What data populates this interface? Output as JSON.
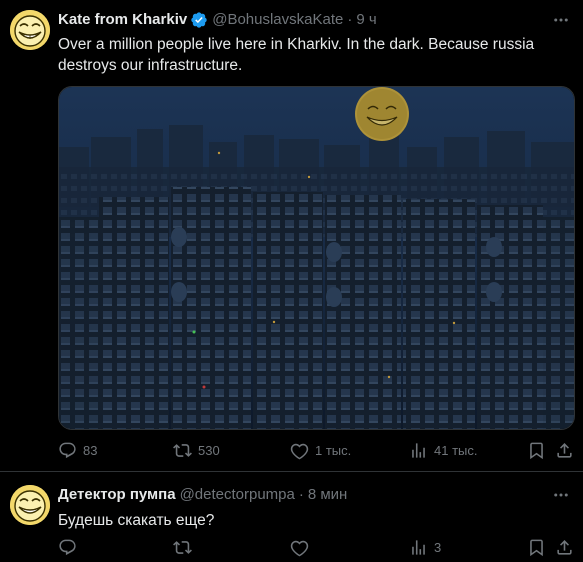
{
  "tweets": [
    {
      "author_name": "Kate from Kharkiv",
      "handle": "@BohuslavskaKate",
      "separator": "·",
      "time": "9 ч",
      "text": "Over a million people live here in Kharkiv.  In the dark.  Because russia destroys our infrastructure.",
      "verified": true,
      "actions": {
        "replies": "83",
        "reposts": "530",
        "likes": "1 тыс.",
        "views": "41 тыс."
      }
    },
    {
      "author_name": "Детектор пумпа",
      "handle": "@detectorpumpa",
      "separator": "·",
      "time": "8 мин",
      "text": "Будешь скакать еще?",
      "verified": false,
      "actions": {
        "replies": "",
        "reposts": "",
        "likes": "",
        "views": "3"
      }
    }
  ],
  "colors": {
    "background": "#000000",
    "text_primary": "#e7e9ea",
    "text_secondary": "#71767b",
    "verified_blue": "#1d9bf0",
    "divider": "#2f3336"
  },
  "icons": [
    "verified-badge-icon",
    "more-icon",
    "reply-icon",
    "repost-icon",
    "like-icon",
    "views-icon",
    "bookmark-icon",
    "share-icon"
  ]
}
